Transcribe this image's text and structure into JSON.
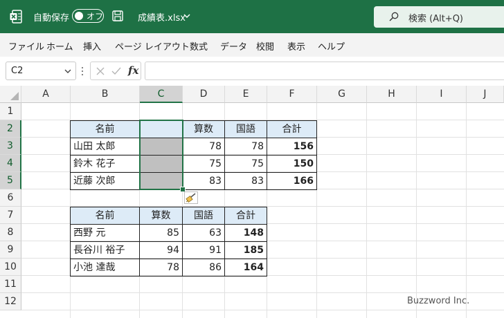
{
  "titlebar": {
    "autosave_label": "自動保存",
    "autosave_state": "オフ",
    "filename": "成績表.xlsx",
    "search_label": "検索 (Alt+Q)",
    "background_color": "#1e7145"
  },
  "menu": [
    "ファイル",
    "ホーム",
    "挿入",
    "ページ レイアウト",
    "数式",
    "データ",
    "校閲",
    "表示",
    "ヘルプ"
  ],
  "formula_bar": {
    "name_box_value": "C2",
    "fx_label": "fx",
    "formula_value": ""
  },
  "columns": [
    "A",
    "B",
    "C",
    "D",
    "E",
    "F",
    "G",
    "H",
    "I",
    "J"
  ],
  "rows": [
    "1",
    "2",
    "3",
    "4",
    "5",
    "6",
    "7",
    "8",
    "9",
    "10",
    "11",
    "12"
  ],
  "selected_column": "C",
  "selected_rows": [
    "2",
    "3",
    "4",
    "5"
  ],
  "table1": {
    "headers": [
      "名前",
      "",
      "算数",
      "国語",
      "合計"
    ],
    "rows": [
      [
        "山田 太郎",
        "",
        "78",
        "78",
        "156"
      ],
      [
        "鈴木 花子",
        "",
        "75",
        "75",
        "150"
      ],
      [
        "近藤 次郎",
        "",
        "83",
        "83",
        "166"
      ]
    ]
  },
  "table2": {
    "headers": [
      "名前",
      "算数",
      "国語",
      "合計"
    ],
    "rows": [
      [
        "西野 元",
        "85",
        "63",
        "148"
      ],
      [
        "長谷川 裕子",
        "94",
        "91",
        "185"
      ],
      [
        "小池 達哉",
        "78",
        "86",
        "164"
      ]
    ]
  },
  "icons": {
    "app": "excel-logo-icon",
    "save": "save-icon",
    "search": "search-icon",
    "paste_options": "paintbrush-icon"
  },
  "accent_color": "#217346",
  "header_fill_color": "#ddebf7",
  "watermark": "Buzzword Inc."
}
